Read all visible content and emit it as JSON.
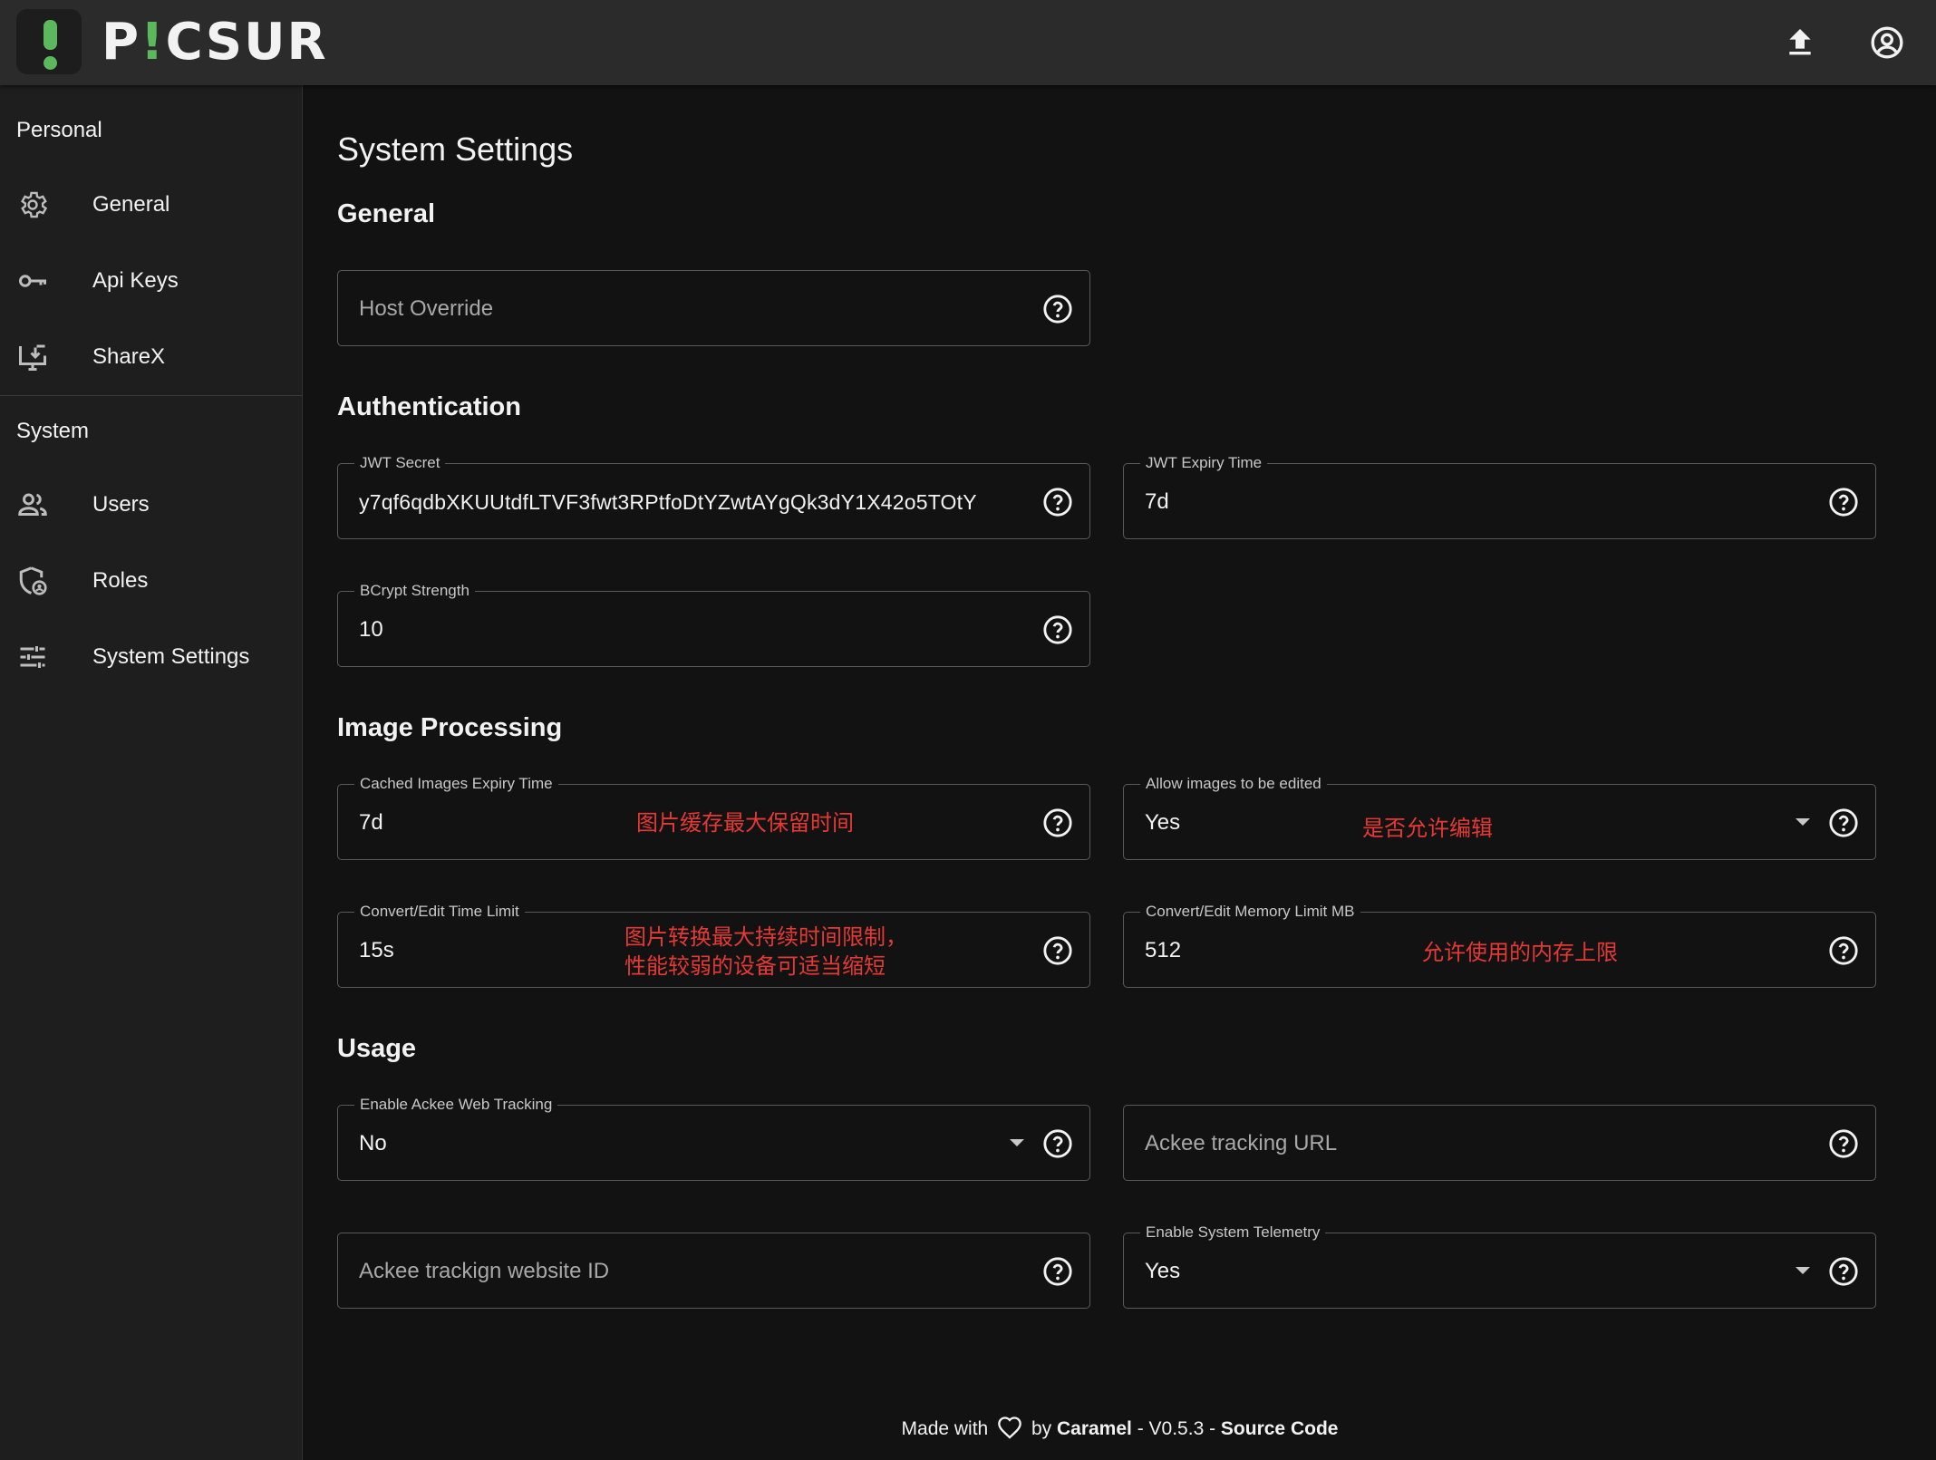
{
  "app": {
    "brand_left": "P",
    "brand_accent": "!",
    "brand_right": "CSUR"
  },
  "sidebar": {
    "personal_title": "Personal",
    "system_title": "System",
    "personal_items": [
      {
        "label": "General",
        "icon": "gear-icon"
      },
      {
        "label": "Api Keys",
        "icon": "key-icon"
      },
      {
        "label": "ShareX",
        "icon": "sharex-download-icon"
      }
    ],
    "system_items": [
      {
        "label": "Users",
        "icon": "users-icon"
      },
      {
        "label": "Roles",
        "icon": "shield-user-icon"
      },
      {
        "label": "System Settings",
        "icon": "tune-sliders-icon"
      }
    ]
  },
  "page": {
    "title": "System Settings",
    "sections": {
      "general": "General",
      "authentication": "Authentication",
      "image_processing": "Image Processing",
      "usage": "Usage"
    }
  },
  "fields": {
    "host_override": {
      "placeholder": "Host Override"
    },
    "jwt_secret": {
      "label": "JWT Secret",
      "value": "y7qf6qdbXKUUtdfLTVF3fwt3RPtfoDtYZwtAYgQk3dY1X42o5TOtY"
    },
    "jwt_expiry": {
      "label": "JWT Expiry Time",
      "value": "7d"
    },
    "bcrypt": {
      "label": "BCrypt Strength",
      "value": "10"
    },
    "cache_expiry": {
      "label": "Cached Images Expiry Time",
      "value": "7d"
    },
    "allow_edit": {
      "label": "Allow images to be edited",
      "value": "Yes"
    },
    "convert_time": {
      "label": "Convert/Edit Time Limit",
      "value": "15s"
    },
    "convert_memory": {
      "label": "Convert/Edit Memory Limit MB",
      "value": "512"
    },
    "ackee_tracking": {
      "label": "Enable Ackee Web Tracking",
      "value": "No"
    },
    "ackee_url": {
      "placeholder": "Ackee tracking URL"
    },
    "ackee_site_id": {
      "placeholder": "Ackee trackign website ID"
    },
    "telemetry": {
      "label": "Enable System Telemetry",
      "value": "Yes"
    }
  },
  "annotations": {
    "cache_expiry": "图片缓存最大保留时间",
    "allow_edit": "是否允许编辑",
    "convert_time_line1": "图片转换最大持续时间限制，",
    "convert_time_line2": "性能较弱的设备可适当缩短",
    "convert_memory": "允许使用的内存上限"
  },
  "footer": {
    "made_with": "Made with",
    "by": "by",
    "author": "Caramel",
    "version": "- V0.5.3 -",
    "source": "Source Code"
  },
  "colors": {
    "accent_green": "#5cb85c",
    "annotation_red": "#e53935",
    "background": "#121212",
    "sidebar": "#1e1e1e",
    "topbar": "#2b2b2b"
  }
}
